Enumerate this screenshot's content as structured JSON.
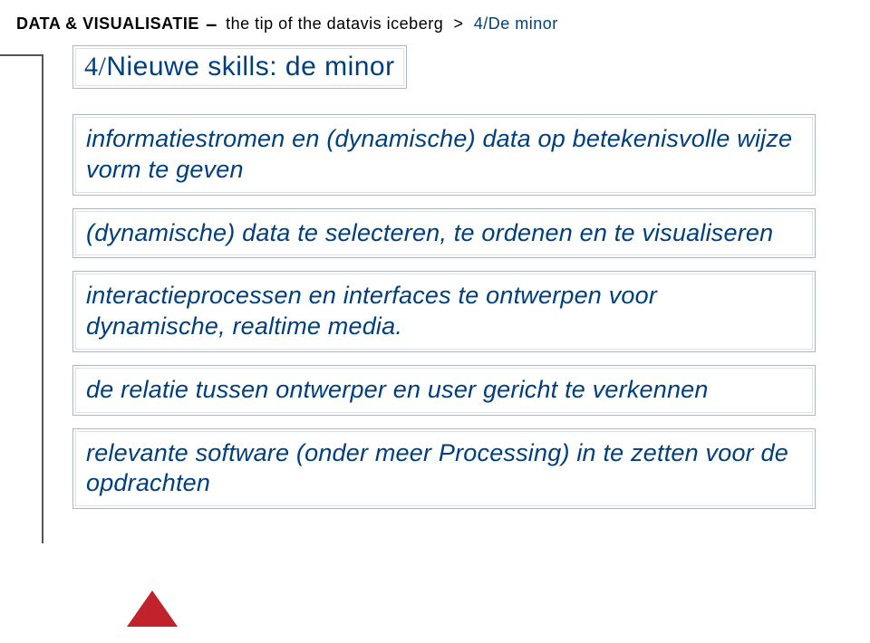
{
  "header": {
    "brand": "DATA & VISUALISATIE",
    "dash": "–",
    "tagline": "the tip of the datavis iceberg",
    "chev": ">",
    "crumb": "4/De minor"
  },
  "title": {
    "prefix": "4/",
    "text": "Nieuwe skills: de minor"
  },
  "items": [
    "informatiestromen en (dynamische) data op betekenisvolle wijze vorm te geven",
    "(dynamische) data te selecteren, te ordenen en te visualiseren",
    "interactieprocessen en interfaces te ontwerpen voor dynamische, realtime media.",
    "de relatie tussen ontwerper en user gericht te verkennen",
    "relevante software (onder meer Processing) in te zetten voor de opdrachten"
  ]
}
